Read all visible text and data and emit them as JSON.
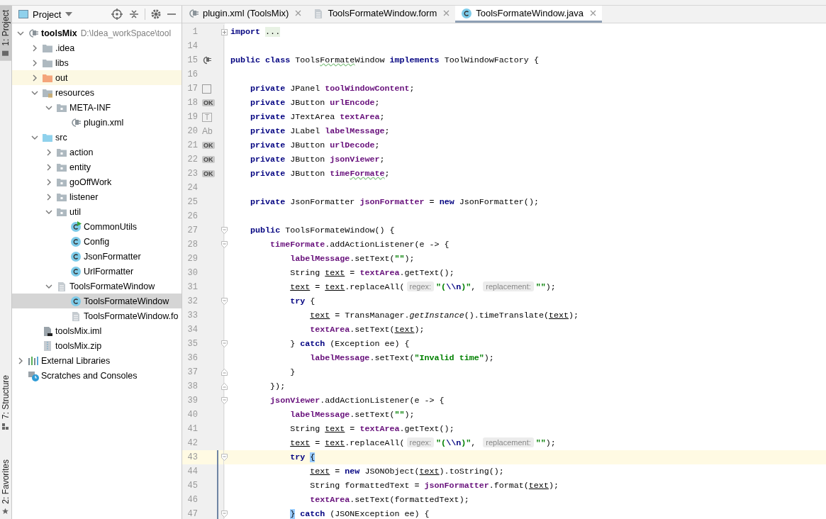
{
  "tool_stripe": [
    {
      "label": "1: Project",
      "kind": "project",
      "selected": true
    },
    {
      "label": "7: Structure",
      "kind": "structure",
      "selected": false
    },
    {
      "label": "2: Favorites",
      "kind": "favorites",
      "selected": false
    }
  ],
  "project_panel": {
    "title": "Project",
    "tree": [
      {
        "label": "toolsMix",
        "path": "D:\\Idea_workSpace\\tool",
        "kind": "module",
        "expanded": true,
        "selected": false,
        "highlighted": false,
        "children": [
          {
            "label": ".idea",
            "kind": "folder",
            "expanded": false,
            "selected": false,
            "highlighted": false
          },
          {
            "label": "libs",
            "kind": "folder",
            "expanded": false,
            "selected": false,
            "highlighted": false
          },
          {
            "label": "out",
            "kind": "excluded",
            "expanded": false,
            "selected": false,
            "highlighted": true
          },
          {
            "label": "resources",
            "kind": "resources",
            "expanded": true,
            "selected": false,
            "highlighted": false,
            "children": [
              {
                "label": "META-INF",
                "kind": "package",
                "expanded": true,
                "selected": false,
                "highlighted": false,
                "children": [
                  {
                    "label": "plugin.xml",
                    "kind": "xml",
                    "selected": false,
                    "highlighted": false
                  }
                ]
              }
            ]
          },
          {
            "label": "src",
            "kind": "source",
            "expanded": true,
            "selected": false,
            "highlighted": false,
            "children": [
              {
                "label": "action",
                "kind": "package",
                "expanded": false,
                "selected": false,
                "highlighted": false
              },
              {
                "label": "entity",
                "kind": "package",
                "expanded": false,
                "selected": false,
                "highlighted": false
              },
              {
                "label": "goOffWork",
                "kind": "package",
                "expanded": false,
                "selected": false,
                "highlighted": false
              },
              {
                "label": "listener",
                "kind": "package",
                "expanded": false,
                "selected": false,
                "highlighted": false
              },
              {
                "label": "util",
                "kind": "package",
                "expanded": true,
                "selected": false,
                "highlighted": false,
                "children": [
                  {
                    "label": "CommonUtils",
                    "kind": "runnable-class",
                    "selected": false,
                    "highlighted": false
                  },
                  {
                    "label": "Config",
                    "kind": "class",
                    "selected": false,
                    "highlighted": false
                  },
                  {
                    "label": "JsonFormatter",
                    "kind": "class",
                    "selected": false,
                    "highlighted": false
                  },
                  {
                    "label": "UrlFormatter",
                    "kind": "class",
                    "selected": false,
                    "highlighted": false
                  }
                ]
              },
              {
                "label": "ToolsFormateWindow",
                "kind": "form",
                "expanded": true,
                "selected": false,
                "highlighted": false,
                "children": [
                  {
                    "label": "ToolsFormateWindow",
                    "kind": "class",
                    "selected": true,
                    "highlighted": false
                  },
                  {
                    "label": "ToolsFormateWindow.fo",
                    "kind": "form",
                    "selected": false,
                    "highlighted": false
                  }
                ]
              }
            ]
          },
          {
            "label": "toolsMix.iml",
            "kind": "iml",
            "selected": false,
            "highlighted": false
          },
          {
            "label": "toolsMix.zip",
            "kind": "zip",
            "selected": false,
            "highlighted": false
          }
        ]
      },
      {
        "label": "External Libraries",
        "kind": "libraries",
        "expanded": false,
        "selected": false,
        "highlighted": false
      },
      {
        "label": "Scratches and Consoles",
        "kind": "scratches",
        "selected": false,
        "highlighted": false
      }
    ]
  },
  "editor_tabs": [
    {
      "label": "plugin.xml (ToolsMix)",
      "kind": "xml",
      "selected": false
    },
    {
      "label": "ToolsFormateWindow.form",
      "kind": "form",
      "selected": false
    },
    {
      "label": "ToolsFormateWindow.java",
      "kind": "class",
      "selected": true
    }
  ],
  "code_lines": [
    {
      "number": "1",
      "fold": {
        "kind": "collapsed"
      },
      "tokens": [
        {
          "text": "import ",
          "kind": "kw"
        },
        {
          "text": "...",
          "kind": "folded"
        }
      ]
    },
    {
      "number": "14"
    },
    {
      "number": "15",
      "gutter": {
        "kind": "implements"
      },
      "tokens": [
        {
          "text": "public class",
          "kind": "kw"
        },
        {
          "text": " Tools"
        },
        {
          "text": "Formate",
          "kind": "typo"
        },
        {
          "text": "Window "
        },
        {
          "text": "implements",
          "kind": "kw"
        },
        {
          "text": " ToolWindowFactory {"
        }
      ]
    },
    {
      "number": "16"
    },
    {
      "number": "17",
      "gutter": {
        "kind": "panel"
      },
      "tokens": [
        {
          "text": "    private",
          "kind": "kw"
        },
        {
          "text": " JPanel "
        },
        {
          "text": "toolWindowContent",
          "kind": "field"
        },
        {
          "text": ";"
        }
      ]
    },
    {
      "number": "18",
      "gutter": {
        "kind": "button",
        "label": "OK"
      },
      "tokens": [
        {
          "text": "    private",
          "kind": "kw"
        },
        {
          "text": " JButton "
        },
        {
          "text": "urlEncode",
          "kind": "field"
        },
        {
          "text": ";"
        }
      ]
    },
    {
      "number": "19",
      "gutter": {
        "kind": "textarea",
        "label": "T"
      },
      "tokens": [
        {
          "text": "    private",
          "kind": "kw"
        },
        {
          "text": " JTextArea "
        },
        {
          "text": "textArea",
          "kind": "field"
        },
        {
          "text": ";"
        }
      ]
    },
    {
      "number": "20",
      "gutter": {
        "kind": "label",
        "label": "Ab"
      },
      "tokens": [
        {
          "text": "    private",
          "kind": "kw"
        },
        {
          "text": " JLabel "
        },
        {
          "text": "labelMessage",
          "kind": "field"
        },
        {
          "text": ";"
        }
      ]
    },
    {
      "number": "21",
      "gutter": {
        "kind": "button",
        "label": "OK"
      },
      "tokens": [
        {
          "text": "    private",
          "kind": "kw"
        },
        {
          "text": " JButton "
        },
        {
          "text": "urlDecode",
          "kind": "field"
        },
        {
          "text": ";"
        }
      ]
    },
    {
      "number": "22",
      "gutter": {
        "kind": "button",
        "label": "OK"
      },
      "tokens": [
        {
          "text": "    private",
          "kind": "kw"
        },
        {
          "text": " JButton "
        },
        {
          "text": "jsonViewer",
          "kind": "field"
        },
        {
          "text": ";"
        }
      ]
    },
    {
      "number": "23",
      "gutter": {
        "kind": "button",
        "label": "OK"
      },
      "tokens": [
        {
          "text": "    private",
          "kind": "kw"
        },
        {
          "text": " JButton "
        },
        {
          "text": "time",
          "kind": "field"
        },
        {
          "text": "Formate",
          "kind": "typo-field"
        },
        {
          "text": ";"
        }
      ]
    },
    {
      "number": "24"
    },
    {
      "number": "25",
      "tokens": [
        {
          "text": "    private",
          "kind": "kw"
        },
        {
          "text": " JsonFormatter "
        },
        {
          "text": "jsonFormatter",
          "kind": "field"
        },
        {
          "text": " = "
        },
        {
          "text": "new",
          "kind": "kw"
        },
        {
          "text": " JsonFormatter();"
        }
      ]
    },
    {
      "number": "26"
    },
    {
      "number": "27",
      "fold": {
        "kind": "start"
      },
      "tokens": [
        {
          "text": "    public",
          "kind": "kw"
        },
        {
          "text": " ToolsFormateWindow() {"
        }
      ]
    },
    {
      "number": "28",
      "fold": {
        "kind": "start"
      },
      "tokens": [
        {
          "text": "        timeFormate",
          "kind": "field"
        },
        {
          "text": ".addActionListener(e -> {"
        }
      ]
    },
    {
      "number": "29",
      "tokens": [
        {
          "text": "            labelMessage",
          "kind": "field"
        },
        {
          "text": ".setText("
        },
        {
          "text": "\"\"",
          "kind": "str"
        },
        {
          "text": ");"
        }
      ]
    },
    {
      "number": "30",
      "tokens": [
        {
          "text": "            String "
        },
        {
          "text": "text",
          "kind": "var"
        },
        {
          "text": " = "
        },
        {
          "text": "textArea",
          "kind": "field"
        },
        {
          "text": ".getText();"
        }
      ]
    },
    {
      "number": "31",
      "tokens": [
        {
          "text": "            text",
          "kind": "var"
        },
        {
          "text": " = "
        },
        {
          "text": "text",
          "kind": "var"
        },
        {
          "text": ".replaceAll("
        },
        {
          "text": "regex:",
          "kind": "hint"
        },
        {
          "text": "\"(",
          "kind": "str"
        },
        {
          "text": "\\\\n",
          "kind": "esc"
        },
        {
          "text": ")\"",
          "kind": "str"
        },
        {
          "text": ", "
        },
        {
          "text": "replacement:",
          "kind": "hint"
        },
        {
          "text": "\"\"",
          "kind": "str"
        },
        {
          "text": ");"
        }
      ]
    },
    {
      "number": "32",
      "fold": {
        "kind": "start"
      },
      "tokens": [
        {
          "text": "            try",
          "kind": "kw"
        },
        {
          "text": " {"
        }
      ]
    },
    {
      "number": "33",
      "tokens": [
        {
          "text": "                text",
          "kind": "var"
        },
        {
          "text": " = TransManager."
        },
        {
          "text": "getInstance",
          "kind": "static"
        },
        {
          "text": "().timeTranslate("
        },
        {
          "text": "text",
          "kind": "var"
        },
        {
          "text": ");"
        }
      ]
    },
    {
      "number": "34",
      "tokens": [
        {
          "text": "                textArea",
          "kind": "field"
        },
        {
          "text": ".setText("
        },
        {
          "text": "text",
          "kind": "var"
        },
        {
          "text": ");"
        }
      ]
    },
    {
      "number": "35",
      "fold": {
        "kind": "start"
      },
      "tokens": [
        {
          "text": "            } "
        },
        {
          "text": "catch",
          "kind": "kw"
        },
        {
          "text": " (Exception ee) {"
        }
      ]
    },
    {
      "number": "36",
      "tokens": [
        {
          "text": "                labelMessage",
          "kind": "field"
        },
        {
          "text": ".setText("
        },
        {
          "text": "\"Invalid time\"",
          "kind": "str"
        },
        {
          "text": ");"
        }
      ]
    },
    {
      "number": "37",
      "fold": {
        "kind": "end"
      },
      "tokens": [
        {
          "text": "            }"
        }
      ]
    },
    {
      "number": "38",
      "fold": {
        "kind": "end"
      },
      "tokens": [
        {
          "text": "        });"
        }
      ]
    },
    {
      "number": "39",
      "fold": {
        "kind": "start"
      },
      "tokens": [
        {
          "text": "        jsonViewer",
          "kind": "field"
        },
        {
          "text": ".addActionListener(e -> {"
        }
      ]
    },
    {
      "number": "40",
      "tokens": [
        {
          "text": "            labelMessage",
          "kind": "field"
        },
        {
          "text": ".setText("
        },
        {
          "text": "\"\"",
          "kind": "str"
        },
        {
          "text": ");"
        }
      ]
    },
    {
      "number": "41",
      "tokens": [
        {
          "text": "            String "
        },
        {
          "text": "text",
          "kind": "var"
        },
        {
          "text": " = "
        },
        {
          "text": "textArea",
          "kind": "field"
        },
        {
          "text": ".getText();"
        }
      ]
    },
    {
      "number": "42",
      "tokens": [
        {
          "text": "            text",
          "kind": "var"
        },
        {
          "text": " = "
        },
        {
          "text": "text",
          "kind": "var"
        },
        {
          "text": ".replaceAll("
        },
        {
          "text": "regex:",
          "kind": "hint"
        },
        {
          "text": "\"(",
          "kind": "str"
        },
        {
          "text": "\\\\n",
          "kind": "esc"
        },
        {
          "text": ")\"",
          "kind": "str"
        },
        {
          "text": ", "
        },
        {
          "text": "replacement:",
          "kind": "hint"
        },
        {
          "text": "\"\"",
          "kind": "str"
        },
        {
          "text": ");"
        }
      ]
    },
    {
      "number": "43",
      "fold": {
        "kind": "start"
      },
      "current": true,
      "changed": true,
      "tokens": [
        {
          "text": "            try ",
          "kind": "kw"
        },
        {
          "text": "{",
          "kind": "match"
        }
      ]
    },
    {
      "number": "44",
      "changed": true,
      "tokens": [
        {
          "text": "                text",
          "kind": "var"
        },
        {
          "text": " = "
        },
        {
          "text": "new",
          "kind": "kw"
        },
        {
          "text": " JSONObject("
        },
        {
          "text": "text",
          "kind": "var"
        },
        {
          "text": ").toString();"
        }
      ]
    },
    {
      "number": "45",
      "changed": true,
      "tokens": [
        {
          "text": "                String formattedText = "
        },
        {
          "text": "jsonFormatter",
          "kind": "field"
        },
        {
          "text": ".format("
        },
        {
          "text": "text",
          "kind": "var"
        },
        {
          "text": ");"
        }
      ]
    },
    {
      "number": "46",
      "changed": true,
      "tokens": [
        {
          "text": "                textArea",
          "kind": "field"
        },
        {
          "text": ".setText(formattedText);"
        }
      ]
    },
    {
      "number": "47",
      "fold": {
        "kind": "start"
      },
      "changed": true,
      "tokens": [
        {
          "text": "            }",
          "kind": "match"
        },
        {
          "text": " catch",
          "kind": "kw"
        },
        {
          "text": " (JSONException ee) {"
        }
      ]
    }
  ]
}
